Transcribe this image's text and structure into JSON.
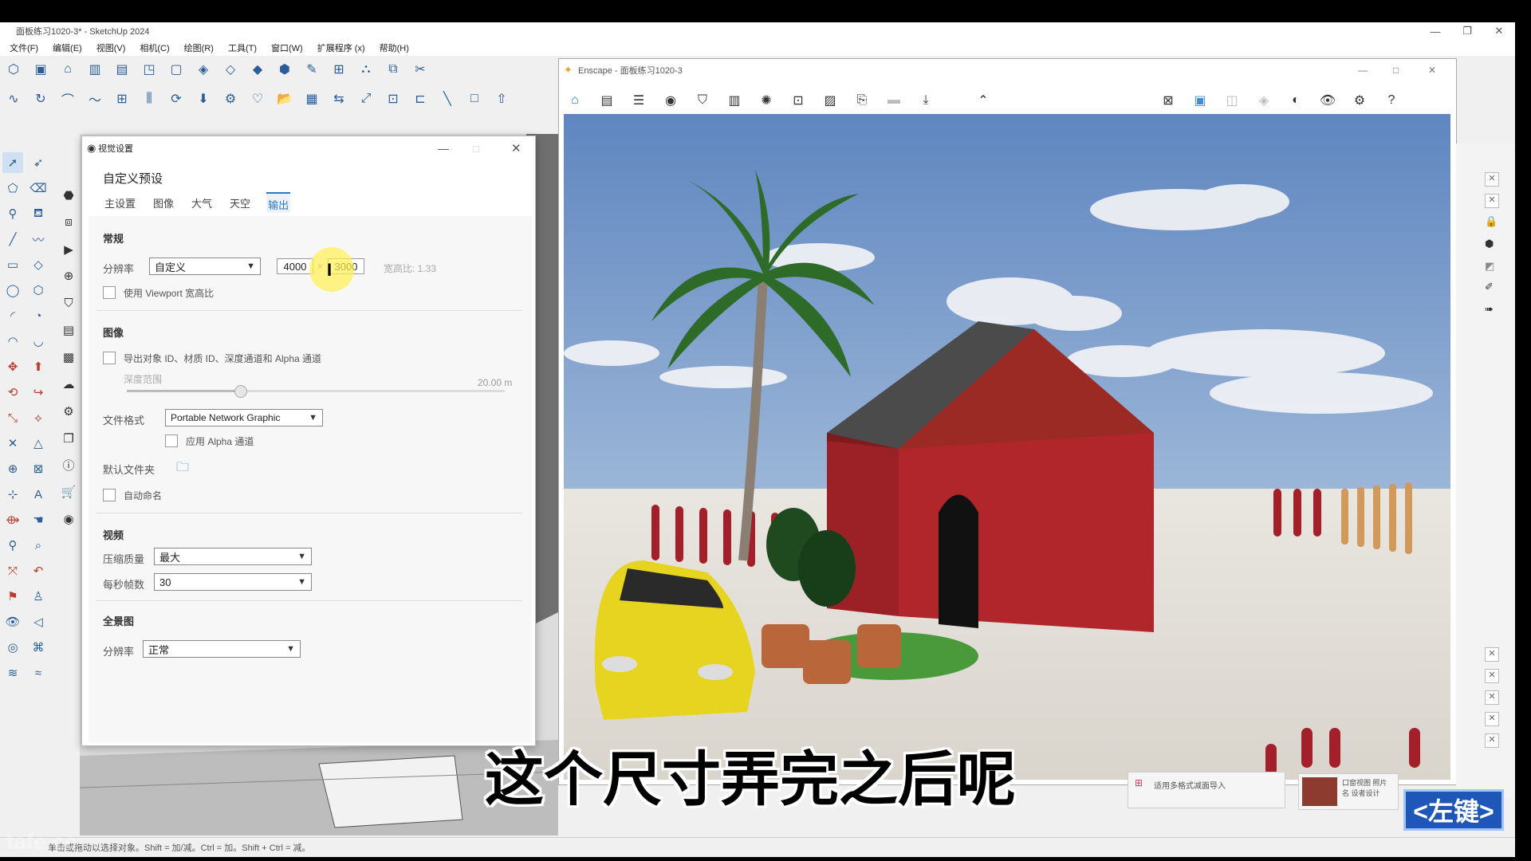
{
  "sketchup": {
    "title": "面板练习1020-3* - SketchUp 2024",
    "menu": [
      "文件(F)",
      "编辑(E)",
      "视图(V)",
      "相机(C)",
      "绘图(R)",
      "工具(T)",
      "窗口(W)",
      "扩展程序 (x)",
      "帮助(H)"
    ],
    "status": "单击或拖动以选择对象。Shift = 加/减。Ctrl = 加。Shift + Ctrl = 减。"
  },
  "visual_settings": {
    "title": "视觉设置",
    "preset": "自定义预设",
    "tabs": [
      "主设置",
      "图像",
      "大气",
      "天空",
      "输出"
    ],
    "active_tab": "输出",
    "general": {
      "title": "常规",
      "resolution_label": "分辨率",
      "resolution_value": "自定义",
      "width": "4000",
      "times": "×",
      "height": "3000",
      "aspect": "宽高比: 1.33",
      "viewport_ratio_label": "使用 Viewport 宽高比"
    },
    "image": {
      "title": "图像",
      "export_ids_label": "导出对象 ID、材质 ID、深度通道和 Alpha 通道",
      "depth_label": "深度范围",
      "depth_value": "20.00 m",
      "depth_fraction": 0.3,
      "format_label": "文件格式",
      "format_value": "Portable Network Graphic",
      "alpha_label": "应用 Alpha 通道",
      "folder_label": "默认文件夹",
      "autoname_label": "自动命名"
    },
    "video": {
      "title": "视频",
      "quality_label": "压缩质量",
      "quality_value": "最大",
      "fps_label": "每秒帧数",
      "fps_value": "30"
    },
    "panorama": {
      "title": "全景图",
      "resolution_label": "分辨率",
      "resolution_value": "正常"
    }
  },
  "enscape": {
    "title": "Enscape - 面板练习1020-3"
  },
  "right_panel": {
    "import_label": "适用多格式减面导入",
    "thumb_label": "口窗视图 照片名 设者设计"
  },
  "overlay": {
    "subtitle": "这个尺寸弄完之后呢",
    "key_badge": "<左键>",
    "watermark": "tafe.cc"
  },
  "colors": {
    "accent": "#2b79c2",
    "house_wall": "#b0262b",
    "roof": "#9c2a24",
    "sky_top": "#6c8fc4"
  }
}
